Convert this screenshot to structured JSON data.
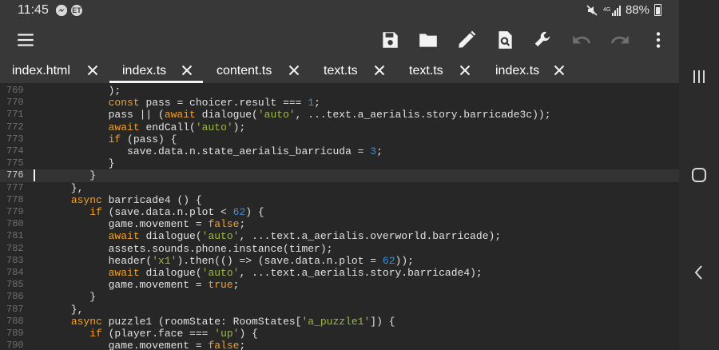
{
  "status_bar": {
    "time": "11:45",
    "notif_icons": [
      "messenger-icon",
      "et-icon"
    ],
    "et_label": "ET",
    "battery": "88%"
  },
  "toolbar": {
    "menu": "menu-icon",
    "save": "save-icon",
    "open": "folder-icon",
    "edit": "pencil-icon",
    "find": "find-in-page-icon",
    "tools": "wrench-icon",
    "undo": "undo-icon",
    "redo": "redo-icon",
    "more": "more-vert-icon"
  },
  "tabs": [
    {
      "label": "index.html",
      "active": false
    },
    {
      "label": "index.ts",
      "active": true
    },
    {
      "label": "content.ts",
      "active": false
    },
    {
      "label": "text.ts",
      "active": false
    },
    {
      "label": "text.ts",
      "active": false
    },
    {
      "label": "index.ts",
      "active": false
    }
  ],
  "editor": {
    "active_line": 776,
    "lines": [
      {
        "n": "769",
        "t": [
          [
            "plain",
            "            );"
          ]
        ]
      },
      {
        "n": "770",
        "t": [
          [
            "plain",
            "            "
          ],
          [
            "kw",
            "const"
          ],
          [
            "plain",
            " pass = choicer.result === "
          ],
          [
            "num",
            "1"
          ],
          [
            "plain",
            ";"
          ]
        ]
      },
      {
        "n": "771",
        "t": [
          [
            "plain",
            "            pass || ("
          ],
          [
            "kw",
            "await"
          ],
          [
            "plain",
            " dialogue("
          ],
          [
            "str",
            "'auto'"
          ],
          [
            "plain",
            ", ...text.a_aerialis.story.barricade3c));"
          ]
        ]
      },
      {
        "n": "772",
        "t": [
          [
            "plain",
            "            "
          ],
          [
            "kw",
            "await"
          ],
          [
            "plain",
            " endCall("
          ],
          [
            "str",
            "'auto'"
          ],
          [
            "plain",
            ");"
          ]
        ]
      },
      {
        "n": "773",
        "t": [
          [
            "plain",
            "            "
          ],
          [
            "kw",
            "if"
          ],
          [
            "plain",
            " (pass) {"
          ]
        ]
      },
      {
        "n": "774",
        "t": [
          [
            "plain",
            "               save.data.n.state_aerialis_barricuda = "
          ],
          [
            "num",
            "3"
          ],
          [
            "plain",
            ";"
          ]
        ]
      },
      {
        "n": "775",
        "t": [
          [
            "plain",
            "            }"
          ]
        ]
      },
      {
        "n": "776",
        "t": [
          [
            "plain",
            "         }"
          ]
        ]
      },
      {
        "n": "777",
        "t": [
          [
            "plain",
            "      },"
          ]
        ]
      },
      {
        "n": "778",
        "t": [
          [
            "plain",
            "      "
          ],
          [
            "kw",
            "async"
          ],
          [
            "plain",
            " barricade4 () {"
          ]
        ]
      },
      {
        "n": "779",
        "t": [
          [
            "plain",
            "         "
          ],
          [
            "kw",
            "if"
          ],
          [
            "plain",
            " (save.data.n.plot < "
          ],
          [
            "num",
            "62"
          ],
          [
            "plain",
            ") {"
          ]
        ]
      },
      {
        "n": "780",
        "t": [
          [
            "plain",
            "            game.movement = "
          ],
          [
            "kw",
            "false"
          ],
          [
            "plain",
            ";"
          ]
        ]
      },
      {
        "n": "781",
        "t": [
          [
            "plain",
            "            "
          ],
          [
            "kw",
            "await"
          ],
          [
            "plain",
            " dialogue("
          ],
          [
            "str",
            "'auto'"
          ],
          [
            "plain",
            ", ...text.a_aerialis.overworld.barricade);"
          ]
        ]
      },
      {
        "n": "782",
        "t": [
          [
            "plain",
            "            assets.sounds.phone.instance(timer);"
          ]
        ]
      },
      {
        "n": "783",
        "t": [
          [
            "plain",
            "            header("
          ],
          [
            "str",
            "'x1'"
          ],
          [
            "plain",
            ").then(() => (save.data.n.plot = "
          ],
          [
            "num",
            "62"
          ],
          [
            "plain",
            "));"
          ]
        ]
      },
      {
        "n": "784",
        "t": [
          [
            "plain",
            "            "
          ],
          [
            "kw",
            "await"
          ],
          [
            "plain",
            " dialogue("
          ],
          [
            "str",
            "'auto'"
          ],
          [
            "plain",
            ", ...text.a_aerialis.story.barricade4);"
          ]
        ]
      },
      {
        "n": "785",
        "t": [
          [
            "plain",
            "            game.movement = "
          ],
          [
            "kw",
            "true"
          ],
          [
            "plain",
            ";"
          ]
        ]
      },
      {
        "n": "786",
        "t": [
          [
            "plain",
            "         }"
          ]
        ]
      },
      {
        "n": "787",
        "t": [
          [
            "plain",
            "      },"
          ]
        ]
      },
      {
        "n": "788",
        "t": [
          [
            "plain",
            "      "
          ],
          [
            "kw",
            "async"
          ],
          [
            "plain",
            " puzzle1 (roomState: RoomStates["
          ],
          [
            "str",
            "'a_puzzle1'"
          ],
          [
            "plain",
            "]) {"
          ]
        ]
      },
      {
        "n": "789",
        "t": [
          [
            "plain",
            "         "
          ],
          [
            "kw",
            "if"
          ],
          [
            "plain",
            " (player.face === "
          ],
          [
            "str",
            "'up'"
          ],
          [
            "plain",
            ") {"
          ]
        ]
      },
      {
        "n": "790",
        "t": [
          [
            "plain",
            "            game.movement = "
          ],
          [
            "kw",
            "false"
          ],
          [
            "plain",
            ";"
          ]
        ]
      }
    ]
  },
  "nav_bar": {
    "recents": "recents-icon",
    "home": "home-icon",
    "back": "back-icon"
  },
  "colors": {
    "keyword": "#f4a020",
    "string": "#9db84a",
    "number": "#3d8fd8",
    "text": "#e2e2e2",
    "toolbar": "#383838",
    "editor_bg": "#272727"
  }
}
